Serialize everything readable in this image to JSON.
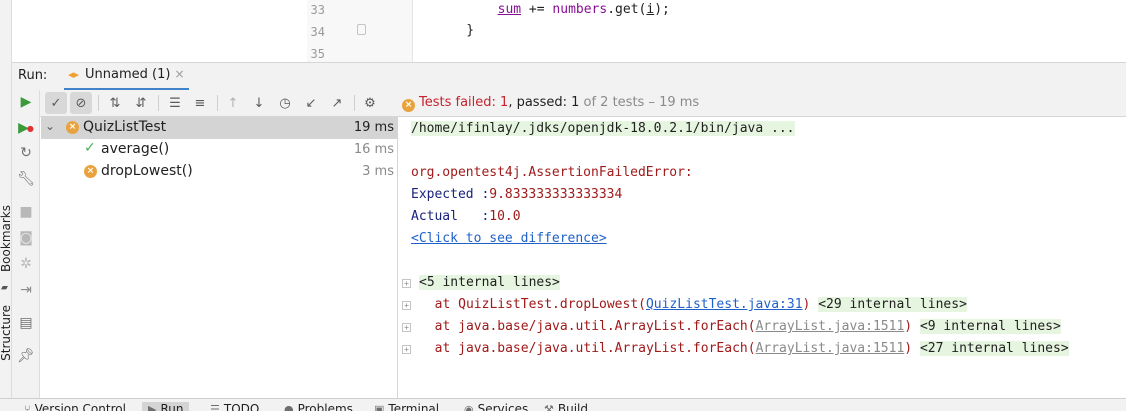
{
  "editor": {
    "line_numbers": [
      "33",
      "34",
      "35"
    ],
    "code_lines": [
      {
        "indent": "        ",
        "var": "sum",
        "op": " += ",
        "field": "numbers",
        "call": ".get(",
        "idx": "i",
        "end": ");"
      },
      {
        "brace": "    }"
      }
    ]
  },
  "left_strip": {
    "bookmarks_label": "Bookmarks",
    "structure_label": "Structure"
  },
  "run_header": {
    "label": "Run:",
    "tab_label": "Unnamed (1)",
    "close_glyph": "×"
  },
  "status": {
    "failed_prefix": "Tests failed: ",
    "failed_count": "1",
    "passed_text": ", passed: 1",
    "suffix": " of 2 tests – 19 ms"
  },
  "tree": {
    "root": {
      "name": "QuizListTest",
      "time": "19 ms",
      "status": "failed"
    },
    "children": [
      {
        "name": "average()",
        "time": "16 ms",
        "status": "passed"
      },
      {
        "name": "dropLowest()",
        "time": "3 ms",
        "status": "failed"
      }
    ]
  },
  "console": {
    "cmd": "/home/ifinlay/.jdks/openjdk-18.0.2.1/bin/java ...",
    "error": "org.opentest4j.AssertionFailedError:",
    "expected_label": "Expected :",
    "expected_value": "9.833333333333334",
    "actual_label": "Actual   :",
    "actual_value": "10.0",
    "diff_link": "<Click to see difference>",
    "internal_first": "<5 internal lines>",
    "frames": [
      {
        "prefix": "at QuizListTest.dropLowest(",
        "link": "QuizListTest.java:31",
        "suffix": ")",
        "internal": "<29 internal lines>",
        "link_style": "blue"
      },
      {
        "prefix": "at java.base/java.util.ArrayList.forEach(",
        "link": "ArrayList.java:1511",
        "suffix": ")",
        "internal": "<9 internal lines>",
        "link_style": "gray"
      },
      {
        "prefix": "at java.base/java.util.ArrayList.forEach(",
        "link": "ArrayList.java:1511",
        "suffix": ")",
        "internal": "<27 internal lines>",
        "link_style": "gray"
      }
    ]
  },
  "bottom_bar": {
    "items": [
      "Version Control",
      "Run",
      "TODO",
      "Problems",
      "Terminal",
      "Services",
      "Build"
    ],
    "active": "Run"
  },
  "colors": {
    "accent": "#4083c9",
    "fail": "#e8a33e",
    "pass": "#4caf50",
    "error_text": "#a01a1a"
  }
}
